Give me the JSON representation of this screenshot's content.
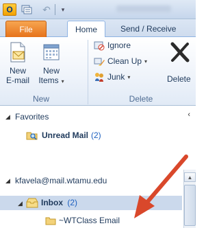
{
  "quick_access": {
    "app_icon": "outlook-icon",
    "app_letter": "O",
    "send_receive_icon": "send-receive-all-icon",
    "undo_icon": "undo-icon",
    "customize_icon": "customize-quick-access-icon"
  },
  "tabs": [
    {
      "label": "File"
    },
    {
      "label": "Home"
    },
    {
      "label": "Send / Receive"
    }
  ],
  "ribbon": {
    "new_group": {
      "label": "New",
      "new_email": {
        "line1": "New",
        "line2": "E-mail"
      },
      "new_items": {
        "line1": "New",
        "line2": "Items"
      }
    },
    "delete_group": {
      "label": "Delete",
      "ignore": "Ignore",
      "clean_up": "Clean Up",
      "junk": "Junk",
      "delete": "Delete"
    }
  },
  "nav": {
    "favorites_label": "Favorites",
    "unread_mail_label": "Unread Mail",
    "unread_mail_count": "(2)",
    "account": "kfavela@mail.wtamu.edu",
    "inbox_label": "Inbox",
    "inbox_count": "(2)",
    "subfolder": "~WTClass Email"
  },
  "colors": {
    "file_tab": "#e6731b",
    "selection": "#cbd9ec",
    "unread_count": "#1c5fbf",
    "annotation_arrow": "#d9482b"
  }
}
